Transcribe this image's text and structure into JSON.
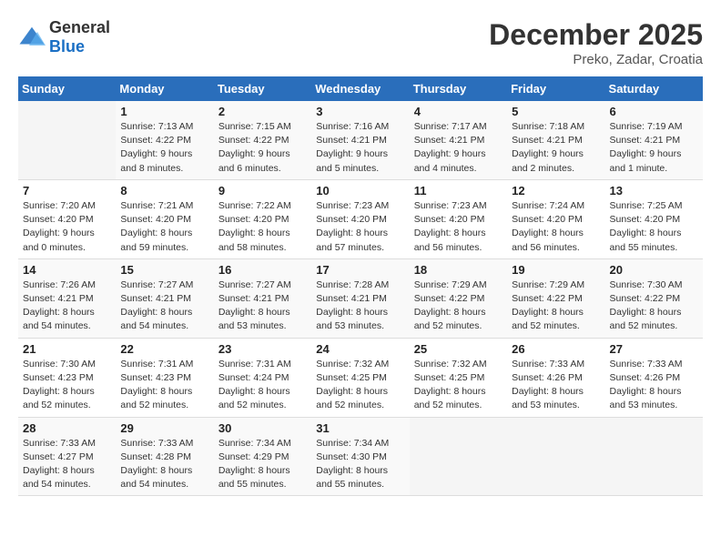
{
  "logo": {
    "general": "General",
    "blue": "Blue"
  },
  "title": "December 2025",
  "location": "Preko, Zadar, Croatia",
  "days_of_week": [
    "Sunday",
    "Monday",
    "Tuesday",
    "Wednesday",
    "Thursday",
    "Friday",
    "Saturday"
  ],
  "weeks": [
    [
      {
        "day": "",
        "sunrise": "",
        "sunset": "",
        "daylight": ""
      },
      {
        "day": "1",
        "sunrise": "Sunrise: 7:13 AM",
        "sunset": "Sunset: 4:22 PM",
        "daylight": "Daylight: 9 hours and 8 minutes."
      },
      {
        "day": "2",
        "sunrise": "Sunrise: 7:15 AM",
        "sunset": "Sunset: 4:22 PM",
        "daylight": "Daylight: 9 hours and 6 minutes."
      },
      {
        "day": "3",
        "sunrise": "Sunrise: 7:16 AM",
        "sunset": "Sunset: 4:21 PM",
        "daylight": "Daylight: 9 hours and 5 minutes."
      },
      {
        "day": "4",
        "sunrise": "Sunrise: 7:17 AM",
        "sunset": "Sunset: 4:21 PM",
        "daylight": "Daylight: 9 hours and 4 minutes."
      },
      {
        "day": "5",
        "sunrise": "Sunrise: 7:18 AM",
        "sunset": "Sunset: 4:21 PM",
        "daylight": "Daylight: 9 hours and 2 minutes."
      },
      {
        "day": "6",
        "sunrise": "Sunrise: 7:19 AM",
        "sunset": "Sunset: 4:21 PM",
        "daylight": "Daylight: 9 hours and 1 minute."
      }
    ],
    [
      {
        "day": "7",
        "sunrise": "Sunrise: 7:20 AM",
        "sunset": "Sunset: 4:20 PM",
        "daylight": "Daylight: 9 hours and 0 minutes."
      },
      {
        "day": "8",
        "sunrise": "Sunrise: 7:21 AM",
        "sunset": "Sunset: 4:20 PM",
        "daylight": "Daylight: 8 hours and 59 minutes."
      },
      {
        "day": "9",
        "sunrise": "Sunrise: 7:22 AM",
        "sunset": "Sunset: 4:20 PM",
        "daylight": "Daylight: 8 hours and 58 minutes."
      },
      {
        "day": "10",
        "sunrise": "Sunrise: 7:23 AM",
        "sunset": "Sunset: 4:20 PM",
        "daylight": "Daylight: 8 hours and 57 minutes."
      },
      {
        "day": "11",
        "sunrise": "Sunrise: 7:23 AM",
        "sunset": "Sunset: 4:20 PM",
        "daylight": "Daylight: 8 hours and 56 minutes."
      },
      {
        "day": "12",
        "sunrise": "Sunrise: 7:24 AM",
        "sunset": "Sunset: 4:20 PM",
        "daylight": "Daylight: 8 hours and 56 minutes."
      },
      {
        "day": "13",
        "sunrise": "Sunrise: 7:25 AM",
        "sunset": "Sunset: 4:20 PM",
        "daylight": "Daylight: 8 hours and 55 minutes."
      }
    ],
    [
      {
        "day": "14",
        "sunrise": "Sunrise: 7:26 AM",
        "sunset": "Sunset: 4:21 PM",
        "daylight": "Daylight: 8 hours and 54 minutes."
      },
      {
        "day": "15",
        "sunrise": "Sunrise: 7:27 AM",
        "sunset": "Sunset: 4:21 PM",
        "daylight": "Daylight: 8 hours and 54 minutes."
      },
      {
        "day": "16",
        "sunrise": "Sunrise: 7:27 AM",
        "sunset": "Sunset: 4:21 PM",
        "daylight": "Daylight: 8 hours and 53 minutes."
      },
      {
        "day": "17",
        "sunrise": "Sunrise: 7:28 AM",
        "sunset": "Sunset: 4:21 PM",
        "daylight": "Daylight: 8 hours and 53 minutes."
      },
      {
        "day": "18",
        "sunrise": "Sunrise: 7:29 AM",
        "sunset": "Sunset: 4:22 PM",
        "daylight": "Daylight: 8 hours and 52 minutes."
      },
      {
        "day": "19",
        "sunrise": "Sunrise: 7:29 AM",
        "sunset": "Sunset: 4:22 PM",
        "daylight": "Daylight: 8 hours and 52 minutes."
      },
      {
        "day": "20",
        "sunrise": "Sunrise: 7:30 AM",
        "sunset": "Sunset: 4:22 PM",
        "daylight": "Daylight: 8 hours and 52 minutes."
      }
    ],
    [
      {
        "day": "21",
        "sunrise": "Sunrise: 7:30 AM",
        "sunset": "Sunset: 4:23 PM",
        "daylight": "Daylight: 8 hours and 52 minutes."
      },
      {
        "day": "22",
        "sunrise": "Sunrise: 7:31 AM",
        "sunset": "Sunset: 4:23 PM",
        "daylight": "Daylight: 8 hours and 52 minutes."
      },
      {
        "day": "23",
        "sunrise": "Sunrise: 7:31 AM",
        "sunset": "Sunset: 4:24 PM",
        "daylight": "Daylight: 8 hours and 52 minutes."
      },
      {
        "day": "24",
        "sunrise": "Sunrise: 7:32 AM",
        "sunset": "Sunset: 4:25 PM",
        "daylight": "Daylight: 8 hours and 52 minutes."
      },
      {
        "day": "25",
        "sunrise": "Sunrise: 7:32 AM",
        "sunset": "Sunset: 4:25 PM",
        "daylight": "Daylight: 8 hours and 52 minutes."
      },
      {
        "day": "26",
        "sunrise": "Sunrise: 7:33 AM",
        "sunset": "Sunset: 4:26 PM",
        "daylight": "Daylight: 8 hours and 53 minutes."
      },
      {
        "day": "27",
        "sunrise": "Sunrise: 7:33 AM",
        "sunset": "Sunset: 4:26 PM",
        "daylight": "Daylight: 8 hours and 53 minutes."
      }
    ],
    [
      {
        "day": "28",
        "sunrise": "Sunrise: 7:33 AM",
        "sunset": "Sunset: 4:27 PM",
        "daylight": "Daylight: 8 hours and 54 minutes."
      },
      {
        "day": "29",
        "sunrise": "Sunrise: 7:33 AM",
        "sunset": "Sunset: 4:28 PM",
        "daylight": "Daylight: 8 hours and 54 minutes."
      },
      {
        "day": "30",
        "sunrise": "Sunrise: 7:34 AM",
        "sunset": "Sunset: 4:29 PM",
        "daylight": "Daylight: 8 hours and 55 minutes."
      },
      {
        "day": "31",
        "sunrise": "Sunrise: 7:34 AM",
        "sunset": "Sunset: 4:30 PM",
        "daylight": "Daylight: 8 hours and 55 minutes."
      },
      {
        "day": "",
        "sunrise": "",
        "sunset": "",
        "daylight": ""
      },
      {
        "day": "",
        "sunrise": "",
        "sunset": "",
        "daylight": ""
      },
      {
        "day": "",
        "sunrise": "",
        "sunset": "",
        "daylight": ""
      }
    ]
  ]
}
